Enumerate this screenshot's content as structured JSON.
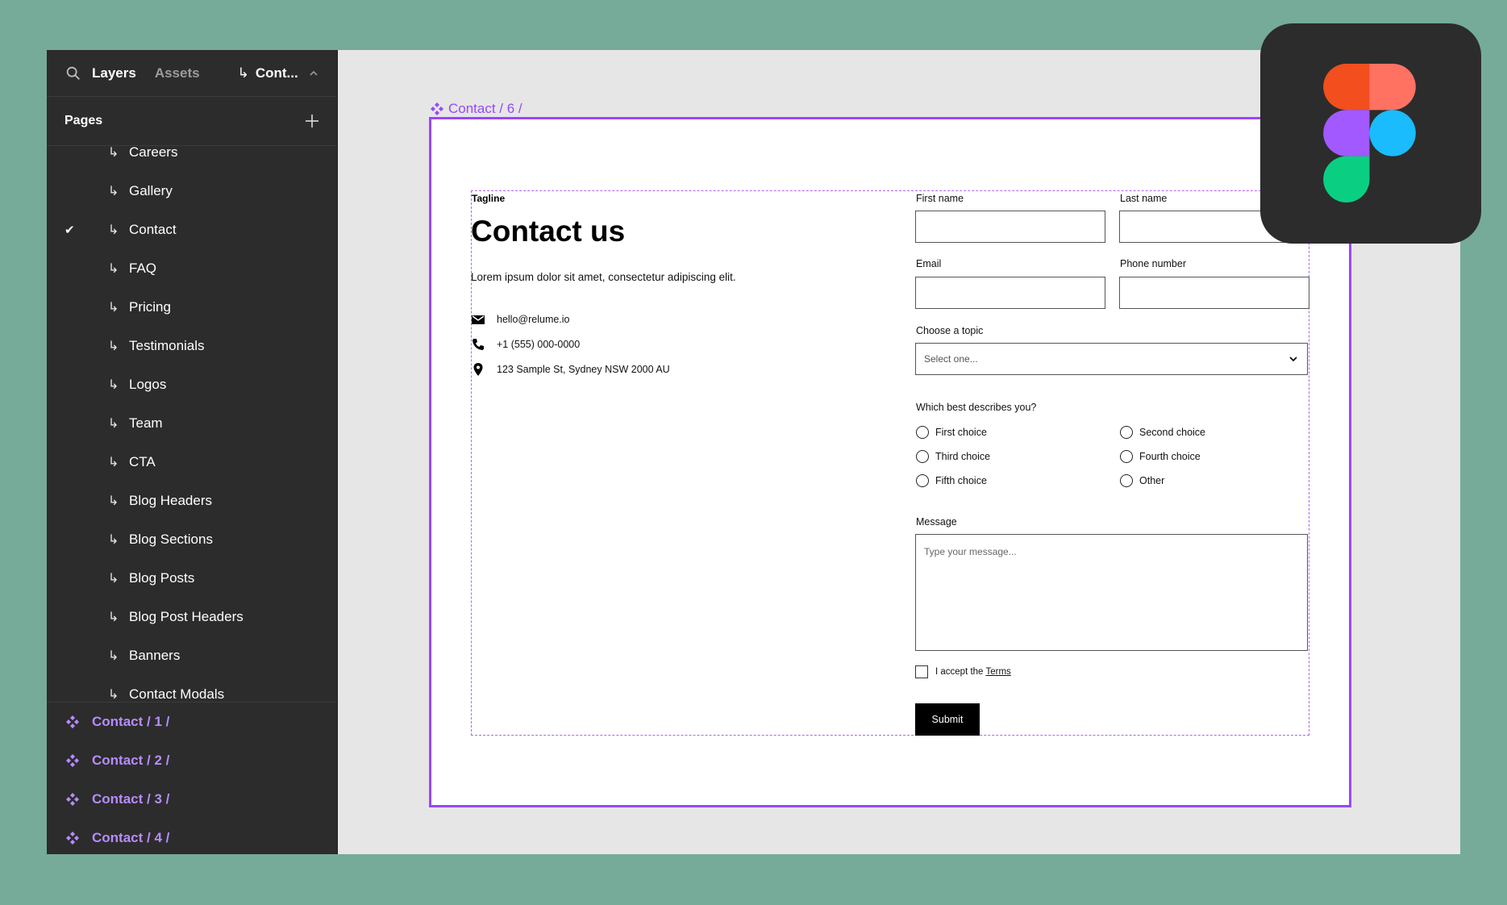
{
  "sidebar": {
    "tabs": [
      "Layers",
      "Assets"
    ],
    "current_page": "Cont...",
    "pages_title": "Pages",
    "pages": [
      {
        "label": "Careers",
        "checked": false
      },
      {
        "label": "Gallery",
        "checked": false
      },
      {
        "label": "Contact",
        "checked": true
      },
      {
        "label": "FAQ",
        "checked": false
      },
      {
        "label": "Pricing",
        "checked": false
      },
      {
        "label": "Testimonials",
        "checked": false
      },
      {
        "label": "Logos",
        "checked": false
      },
      {
        "label": "Team",
        "checked": false
      },
      {
        "label": "CTA",
        "checked": false
      },
      {
        "label": "Blog Headers",
        "checked": false
      },
      {
        "label": "Blog Sections",
        "checked": false
      },
      {
        "label": "Blog Posts",
        "checked": false
      },
      {
        "label": "Blog Post Headers",
        "checked": false
      },
      {
        "label": "Banners",
        "checked": false
      },
      {
        "label": "Contact Modals",
        "checked": false
      }
    ],
    "components": [
      "Contact / 1 /",
      "Contact / 2 /",
      "Contact / 3 /",
      "Contact / 4 /"
    ]
  },
  "canvas": {
    "frame_label": "Contact / 6 /",
    "accent_color": "#9747ff",
    "tagline": "Tagline",
    "heading": "Contact us",
    "lead": "Lorem ipsum dolor sit amet, consectetur adipiscing elit.",
    "email": "hello@relume.io",
    "phone": "+1 (555) 000-0000",
    "address": "123 Sample St, Sydney NSW 2000 AU",
    "form": {
      "first_name_label": "First name",
      "last_name_label": "Last name",
      "email_label": "Email",
      "phone_label": "Phone number",
      "topic_label": "Choose a topic",
      "topic_placeholder": "Select one...",
      "describe_label": "Which best describes you?",
      "choices": [
        "First choice",
        "Second choice",
        "Third choice",
        "Fourth choice",
        "Fifth choice",
        "Other"
      ],
      "message_label": "Message",
      "message_placeholder": "Type your message...",
      "accept_text": "I accept the",
      "terms_link": "Terms",
      "submit_label": "Submit"
    }
  },
  "logo": {
    "name": "figma-logo",
    "colors": [
      "#f24e1e",
      "#ff7262",
      "#a259ff",
      "#1abcfe",
      "#0acf83"
    ]
  }
}
